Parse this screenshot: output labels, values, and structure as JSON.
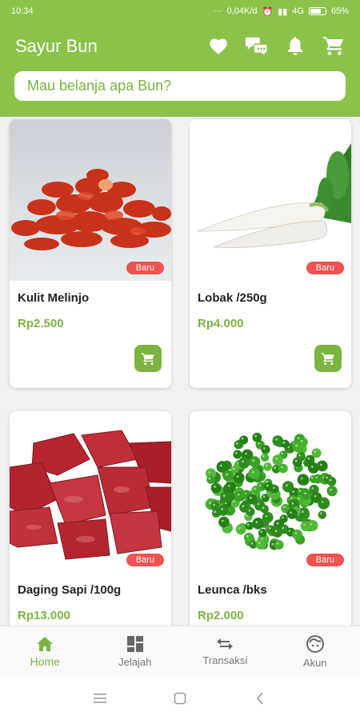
{
  "status": {
    "time": "10:34",
    "network_speed": "0,04K/d",
    "network_type": "4G",
    "battery": "65%",
    "icons": [
      "dots-icon",
      "alarm-icon",
      "signal-icon",
      "battery-icon"
    ]
  },
  "header": {
    "title": "Sayur Bun",
    "icons": [
      "heart-icon",
      "chat-icon",
      "bell-icon",
      "cart-icon"
    ],
    "search_placeholder": "Mau belanja apa Bun?"
  },
  "products": [
    {
      "name": "Kulit Melinjo",
      "price": "Rp2.500",
      "badge": "Baru",
      "image": "kulit-melinjo-image"
    },
    {
      "name": "Lobak /250g",
      "price": "Rp4.000",
      "badge": "Baru",
      "image": "lobak-image"
    },
    {
      "name": "Daging Sapi /100g",
      "price": "Rp13.000",
      "badge": "Baru",
      "image": "daging-sapi-image"
    },
    {
      "name": "Leunca /bks",
      "price": "Rp2.000",
      "badge": "Baru",
      "image": "leunca-image"
    }
  ],
  "bottom_nav": [
    {
      "label": "Home",
      "icon": "home-icon",
      "active": true
    },
    {
      "label": "Jelajah",
      "icon": "grid-icon",
      "active": false
    },
    {
      "label": "Transaksi",
      "icon": "swap-icon",
      "active": false
    },
    {
      "label": "Akun",
      "icon": "face-icon",
      "active": false
    }
  ],
  "colors": {
    "primary": "#8bc34a",
    "price": "#7cb342",
    "badge": "#ef5350"
  }
}
